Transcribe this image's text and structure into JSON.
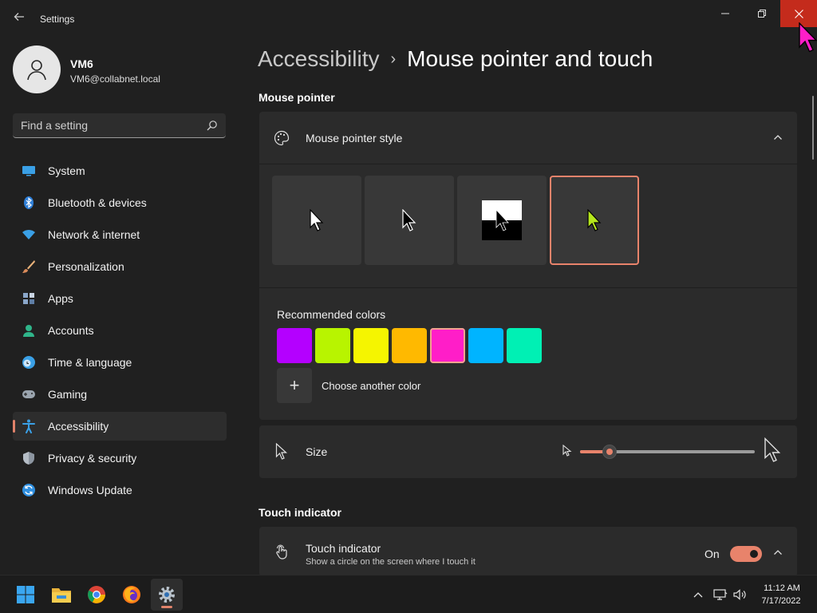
{
  "window": {
    "title": "Settings",
    "back_icon": "arrow-left-icon",
    "controls": [
      "minimize-icon",
      "maximize-icon",
      "close-icon"
    ]
  },
  "user": {
    "name": "VM6",
    "email": "VM6@collabnet.local"
  },
  "search": {
    "placeholder": "Find a setting",
    "value": ""
  },
  "sidebar": {
    "items": [
      {
        "label": "System",
        "icon": "monitor-icon"
      },
      {
        "label": "Bluetooth & devices",
        "icon": "bluetooth-icon"
      },
      {
        "label": "Network & internet",
        "icon": "wifi-icon"
      },
      {
        "label": "Personalization",
        "icon": "brush-icon"
      },
      {
        "label": "Apps",
        "icon": "apps-icon"
      },
      {
        "label": "Accounts",
        "icon": "person-icon"
      },
      {
        "label": "Time & language",
        "icon": "clock-globe-icon"
      },
      {
        "label": "Gaming",
        "icon": "gamepad-icon"
      },
      {
        "label": "Accessibility",
        "icon": "accessibility-icon",
        "active": true
      },
      {
        "label": "Privacy & security",
        "icon": "shield-icon"
      },
      {
        "label": "Windows Update",
        "icon": "update-icon"
      }
    ]
  },
  "breadcrumb": {
    "parent": "Accessibility",
    "separator": "›",
    "current": "Mouse pointer and touch"
  },
  "sections": {
    "mouse_pointer": "Mouse pointer",
    "touch_indicator": "Touch indicator"
  },
  "pointer_style": {
    "label": "Mouse pointer style",
    "icon": "palette-icon",
    "expanded": true,
    "options": [
      {
        "name": "white",
        "selected": false
      },
      {
        "name": "black",
        "selected": false
      },
      {
        "name": "inverted",
        "selected": false
      },
      {
        "name": "custom",
        "selected": true,
        "color": "#b5e61d"
      }
    ],
    "recommended_label": "Recommended colors",
    "colors": [
      "#b400ff",
      "#b8f400",
      "#f5f500",
      "#ffb900",
      "#ff1ec8",
      "#00b4ff",
      "#00f0b4"
    ],
    "selected_color_index": 4,
    "choose_label": "Choose another color"
  },
  "size": {
    "label": "Size",
    "icon": "pointer-icon",
    "value_fraction": 0.17
  },
  "touch": {
    "label": "Touch indicator",
    "description": "Show a circle on the screen where I touch it",
    "state": "On",
    "icon": "touch-icon"
  },
  "taskbar": {
    "apps": [
      "windows-start-icon",
      "file-explorer-icon",
      "chrome-icon",
      "firefox-icon",
      "settings-icon"
    ],
    "active_app": "settings-icon",
    "time": "11:12 AM",
    "date": "7/17/2022"
  },
  "colors": {
    "accent": "#e8836b",
    "close_button": "#c42b1c",
    "background": "#202020",
    "card": "#2b2b2b"
  }
}
